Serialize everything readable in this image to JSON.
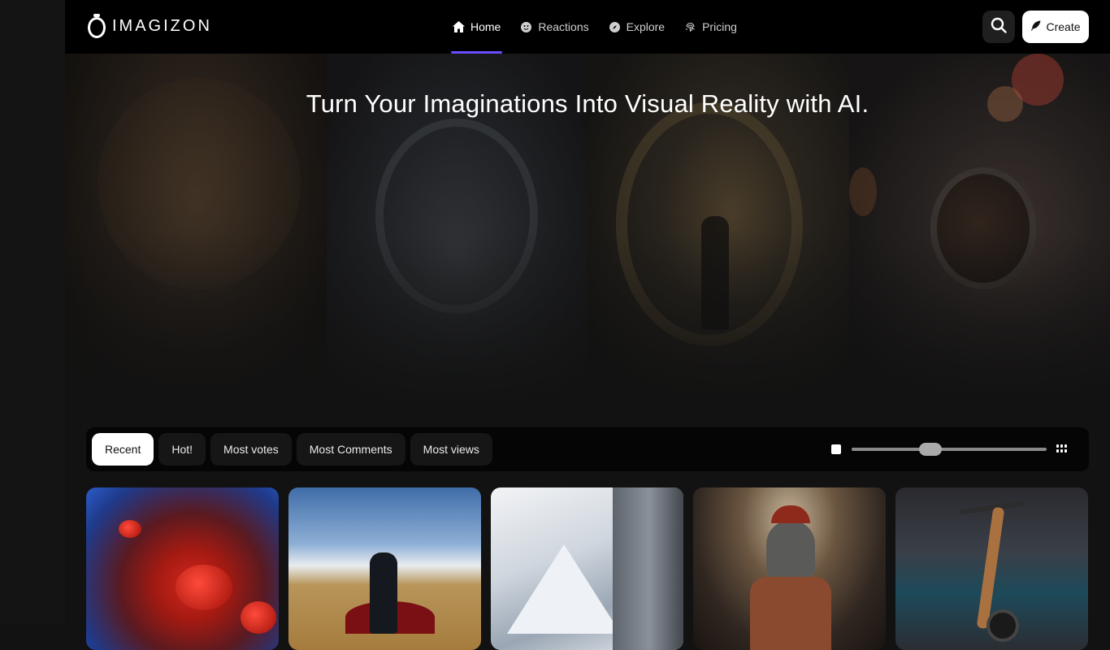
{
  "header": {
    "logo_text": "IMAGIZON",
    "nav": [
      {
        "label": "Home",
        "icon": "home-icon",
        "active": true
      },
      {
        "label": "Reactions",
        "icon": "emoji-icon",
        "active": false
      },
      {
        "label": "Explore",
        "icon": "compass-icon",
        "active": false
      },
      {
        "label": "Pricing",
        "icon": "fingerprint-icon",
        "active": false
      }
    ],
    "search_icon": "search-icon",
    "create_label": "Create",
    "create_icon": "feather-icon",
    "accent_color": "#6b4cff"
  },
  "hero": {
    "title": "Turn Your Imaginations Into Visual Reality with AI."
  },
  "filters": {
    "tabs": [
      "Recent",
      "Hot!",
      "Most votes",
      "Most Comments",
      "Most views"
    ],
    "active_tab": "Recent",
    "grid_size_level": 0.39
  },
  "gallery": {
    "cards": [
      {
        "subject": "red blood cells"
      },
      {
        "subject": "woman in field"
      },
      {
        "subject": "snowy mountains"
      },
      {
        "subject": "spartan warriors"
      },
      {
        "subject": "wooden scooter"
      }
    ]
  }
}
